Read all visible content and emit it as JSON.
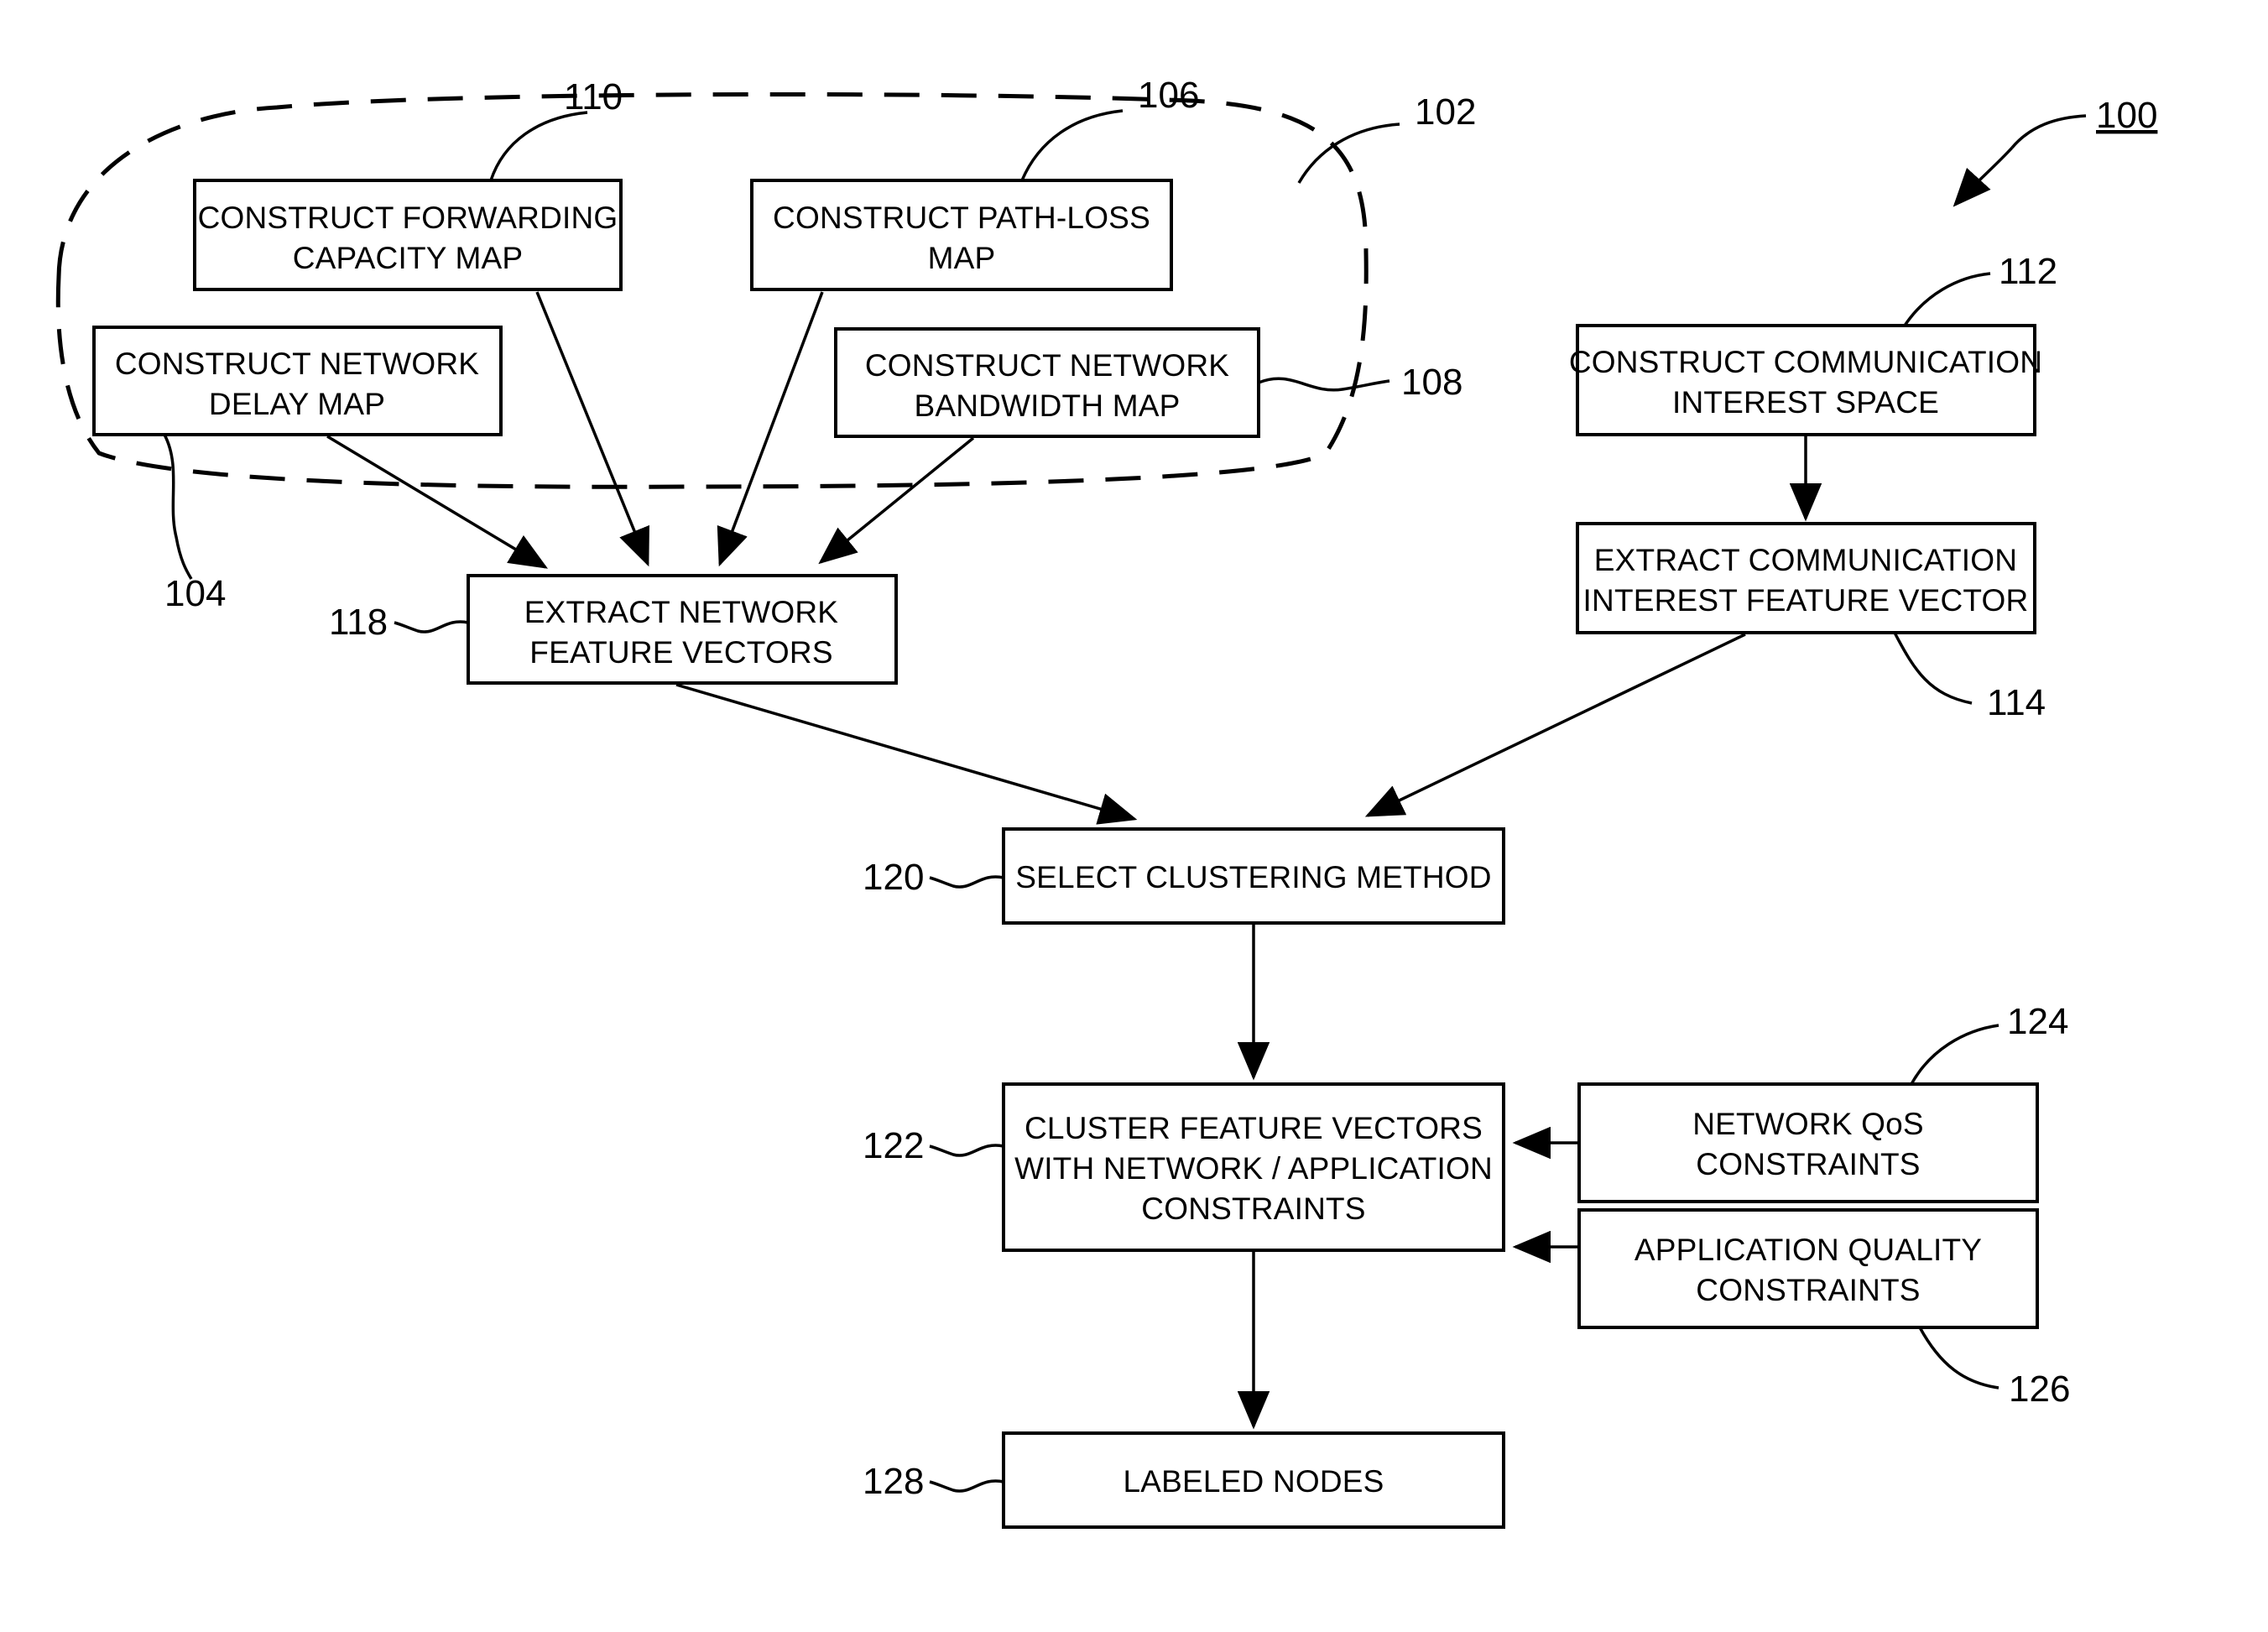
{
  "figure": {
    "label_100": "100",
    "group_label_102": "102",
    "group_label_104": "104"
  },
  "boxes": [
    {
      "id": "forwarding-capacity-map",
      "ref": "110",
      "lines": [
        "CONSTRUCT FORWARDING",
        "CAPACITY MAP"
      ]
    },
    {
      "id": "path-loss-map",
      "ref": "106",
      "lines": [
        "CONSTRUCT PATH-LOSS",
        "MAP"
      ]
    },
    {
      "id": "network-delay-map",
      "ref": "104",
      "lines": [
        "CONSTRUCT NETWORK",
        "DELAY MAP"
      ]
    },
    {
      "id": "network-bandwidth-map",
      "ref": "108",
      "lines": [
        "CONSTRUCT NETWORK",
        "BANDWIDTH MAP"
      ]
    },
    {
      "id": "communication-interest-space",
      "ref": "112",
      "lines": [
        "CONSTRUCT COMMUNICATION",
        "INTEREST SPACE"
      ]
    },
    {
      "id": "extract-communication-interest-feature-vector",
      "ref": "114",
      "lines": [
        "EXTRACT COMMUNICATION",
        "INTEREST FEATURE VECTOR"
      ]
    },
    {
      "id": "extract-network-feature-vectors",
      "ref": "118",
      "lines": [
        "EXTRACT NETWORK",
        "FEATURE VECTORS"
      ]
    },
    {
      "id": "select-clustering-method",
      "ref": "120",
      "lines": [
        "SELECT CLUSTERING METHOD"
      ]
    },
    {
      "id": "cluster-feature-vectors",
      "ref": "122",
      "lines": [
        "CLUSTER FEATURE VECTORS",
        "WITH NETWORK / APPLICATION",
        "CONSTRAINTS"
      ]
    },
    {
      "id": "network-qos-constraints",
      "ref": "124",
      "lines": [
        "NETWORK QoS",
        "CONSTRAINTS"
      ]
    },
    {
      "id": "application-quality-constraints",
      "ref": "126",
      "lines": [
        "APPLICATION QUALITY",
        "CONSTRAINTS"
      ]
    },
    {
      "id": "labeled-nodes",
      "ref": "128",
      "lines": [
        "LABELED NODES"
      ]
    }
  ],
  "refs": {
    "r100": "100",
    "r102": "102",
    "r104": "104",
    "r106": "106",
    "r108": "108",
    "r110": "110",
    "r112": "112",
    "r114": "114",
    "r118": "118",
    "r120": "120",
    "r122": "122",
    "r124": "124",
    "r126": "126",
    "r128": "128"
  },
  "colors": {
    "stroke": "#000000",
    "background": "#ffffff"
  }
}
